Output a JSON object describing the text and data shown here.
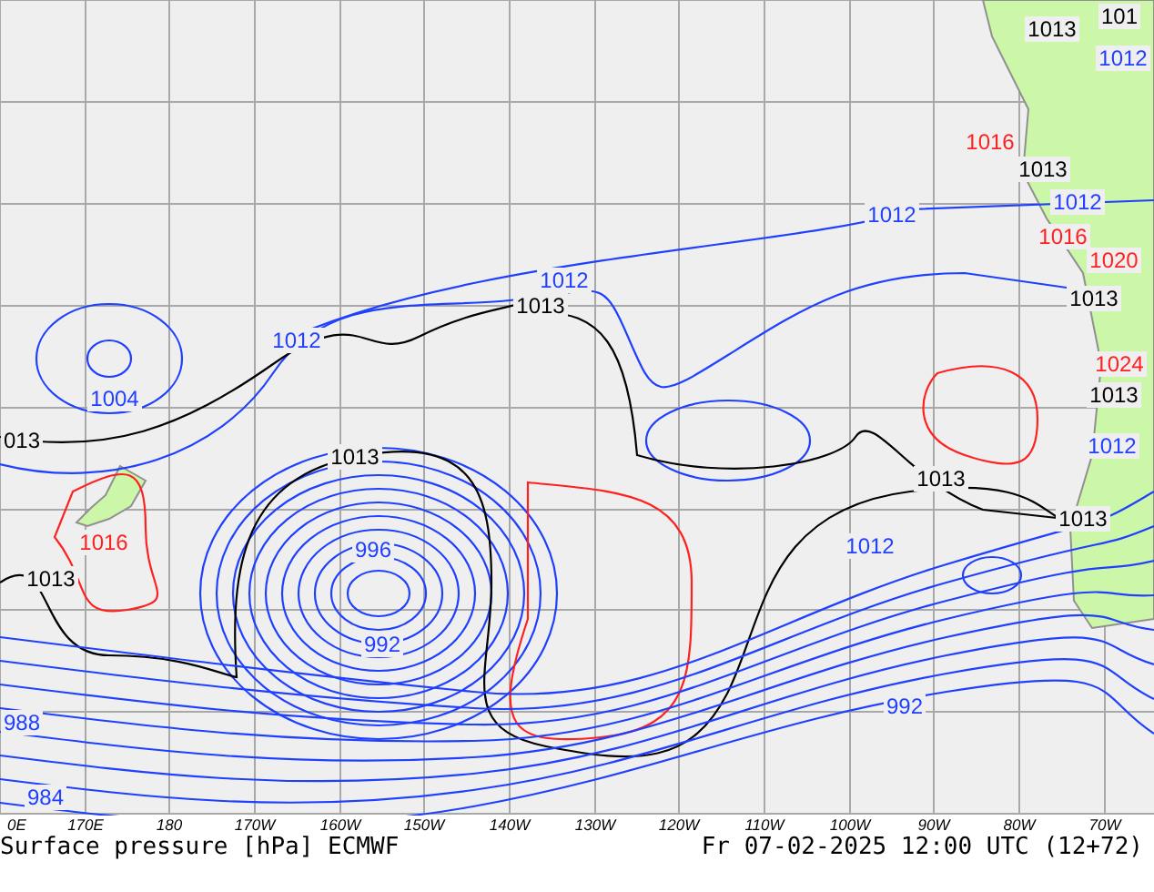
{
  "map": {
    "longitude_labels": [
      "0E",
      "170E",
      "180",
      "170W",
      "160W",
      "150W",
      "140W",
      "130W",
      "120W",
      "110W",
      "100W",
      "90W",
      "80W",
      "70W"
    ],
    "isobar_labels": [
      {
        "text": "1013",
        "color": "#000000"
      },
      {
        "text": "101",
        "color": "#000000"
      },
      {
        "text": "1012",
        "color": "#2040ff"
      },
      {
        "text": "1016",
        "color": "#ff2020"
      },
      {
        "text": "1013",
        "color": "#000000"
      },
      {
        "text": "1012",
        "color": "#2040ff"
      },
      {
        "text": "1012",
        "color": "#2040ff"
      },
      {
        "text": "1016",
        "color": "#ff2020"
      },
      {
        "text": "1020",
        "color": "#ff2020"
      },
      {
        "text": "1013",
        "color": "#000000"
      },
      {
        "text": "1024",
        "color": "#ff2020"
      },
      {
        "text": "1013",
        "color": "#000000"
      },
      {
        "text": "1012",
        "color": "#2040ff"
      },
      {
        "text": "1013",
        "color": "#000000"
      },
      {
        "text": "1013",
        "color": "#000000"
      },
      {
        "text": "1012",
        "color": "#2040ff"
      },
      {
        "text": "992",
        "color": "#2040ff"
      },
      {
        "text": "1012",
        "color": "#2040ff"
      },
      {
        "text": "1013",
        "color": "#000000"
      },
      {
        "text": "1012",
        "color": "#2040ff"
      },
      {
        "text": "1004",
        "color": "#2040ff"
      },
      {
        "text": "013",
        "color": "#000000"
      },
      {
        "text": "1013",
        "color": "#000000"
      },
      {
        "text": "996",
        "color": "#2040ff"
      },
      {
        "text": "992",
        "color": "#2040ff"
      },
      {
        "text": "1016",
        "color": "#ff2020"
      },
      {
        "text": "1013",
        "color": "#000000"
      },
      {
        "text": "988",
        "color": "#2040ff"
      },
      {
        "text": "984",
        "color": "#2040ff"
      }
    ]
  },
  "footer": {
    "title": "Surface pressure [hPa] ECMWF",
    "valid_time": "Fr 07-02-2025 12:00 UTC (12+72)"
  }
}
